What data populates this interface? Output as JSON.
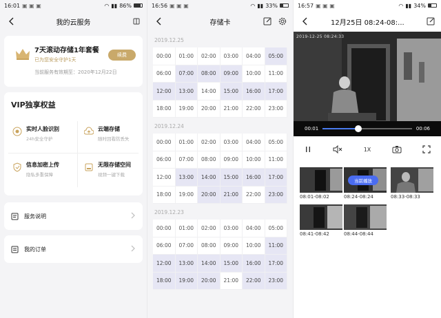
{
  "screen1": {
    "status": {
      "time": "16:01",
      "battery": "86%"
    },
    "title": "我的云服务",
    "promo": {
      "title": "7天滚动存储1年套餐",
      "subtitle": "已为您安全守护1天",
      "expiry": "当前服务有效期至：2020年12月22日",
      "renew_label": "续费"
    },
    "vip": {
      "title": "VIP独享权益",
      "features": [
        {
          "title": "实时人脸识别",
          "desc": "24h安全守护",
          "icon": "face-recognition-icon"
        },
        {
          "title": "云端存储",
          "desc": "随时回看防丢失",
          "icon": "cloud-upload-icon"
        },
        {
          "title": "信息加密上传",
          "desc": "隐私多重保障",
          "icon": "shield-icon"
        },
        {
          "title": "无限存储空间",
          "desc": "视频一键下载",
          "icon": "storage-icon"
        }
      ]
    },
    "rows": [
      {
        "label": "服务说明",
        "icon": "document-icon"
      },
      {
        "label": "我的订单",
        "icon": "order-icon"
      }
    ]
  },
  "screen2": {
    "status": {
      "time": "16:56",
      "battery": "33%"
    },
    "title": "存储卡",
    "days": [
      {
        "date": "2019.12.25",
        "cells": [
          "00:00",
          "01:00",
          "02:00",
          "03:00",
          "04:00",
          "05:00",
          "06:00",
          "07:00",
          "08:00",
          "09:00",
          "10:00",
          "11:00",
          "12:00",
          "13:00",
          "14:00",
          "15:00",
          "16:00",
          "17:00",
          "18:00",
          "19:00",
          "20:00",
          "21:00",
          "22:00",
          "23:00"
        ],
        "recorded": [
          5,
          7,
          8,
          9,
          12,
          13,
          15,
          16,
          17
        ]
      },
      {
        "date": "2019.12.24",
        "cells": [
          "00:00",
          "01:00",
          "02:00",
          "03:00",
          "04:00",
          "05:00",
          "06:00",
          "07:00",
          "08:00",
          "09:00",
          "10:00",
          "11:00",
          "12:00",
          "13:00",
          "14:00",
          "15:00",
          "16:00",
          "17:00",
          "18:00",
          "19:00",
          "20:00",
          "21:00",
          "22:00",
          "23:00"
        ],
        "recorded": [
          13,
          14,
          15,
          16,
          17,
          20,
          21,
          23
        ]
      },
      {
        "date": "2019.12.23",
        "cells": [
          "00:00",
          "01:00",
          "02:00",
          "03:00",
          "04:00",
          "05:00",
          "06:00",
          "07:00",
          "08:00",
          "09:00",
          "10:00",
          "11:00",
          "12:00",
          "13:00",
          "14:00",
          "15:00",
          "16:00",
          "17:00",
          "18:00",
          "19:00",
          "20:00",
          "21:00",
          "22:00",
          "23:00"
        ],
        "recorded": [
          11,
          12,
          13,
          14,
          15,
          16,
          17,
          18,
          19,
          20,
          22,
          23
        ]
      }
    ]
  },
  "screen3": {
    "status": {
      "time": "16:57",
      "battery": "34%"
    },
    "title": "12月25日 08:24-08:...",
    "video": {
      "overlay_timestamp": "2019-12-25 08:24:33",
      "current": "00:01",
      "duration": "00:06",
      "progress": 0.4
    },
    "controls": {
      "speed": "1X"
    },
    "now_playing": "当前播放",
    "clips": [
      "08:01-08:02",
      "08:24-08:24",
      "08:33-08:33",
      "08:41-08:42",
      "08:44-08:44"
    ]
  }
}
